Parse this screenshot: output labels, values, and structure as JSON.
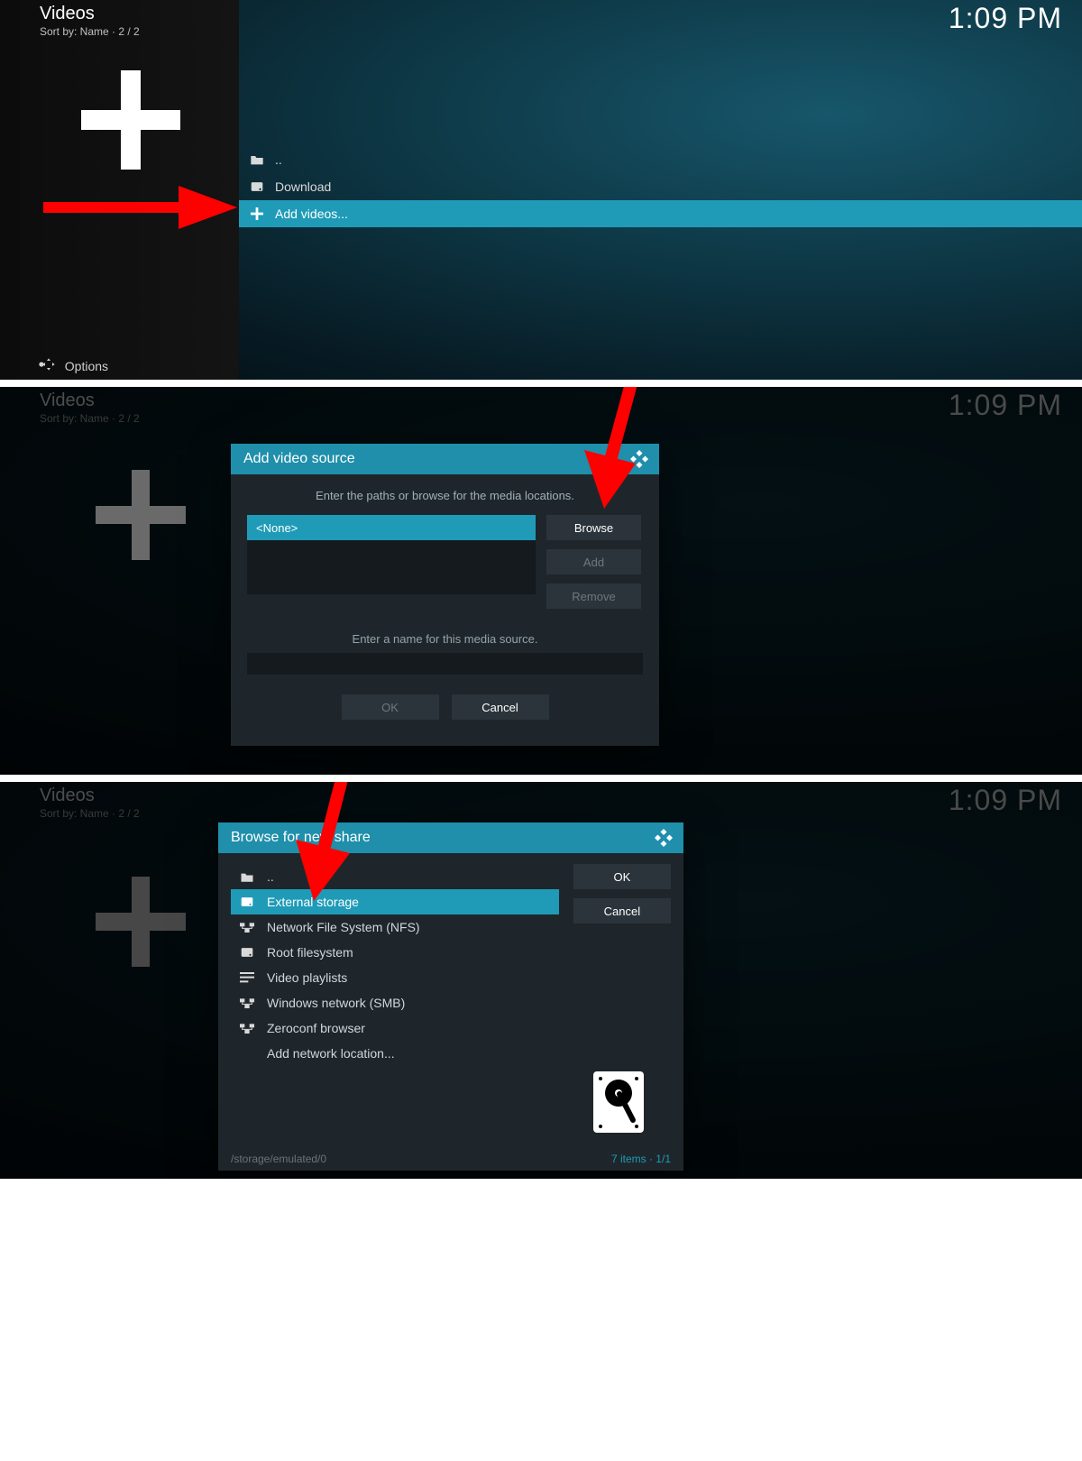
{
  "panel1": {
    "title": "Videos",
    "subtitle": "Sort by: Name  ·  2 / 2",
    "clock": "1:09 PM",
    "rows": {
      "up": "..",
      "download": "Download",
      "addvideos": "Add videos..."
    },
    "options": "Options"
  },
  "panel2": {
    "title": "Videos",
    "subtitle": "Sort by: Name  ·  2 / 2",
    "clock": "1:09 PM",
    "dialog_title": "Add video source",
    "instruction": "Enter the paths or browse for the media locations.",
    "path_none": "<None>",
    "browse": "Browse",
    "add": "Add",
    "remove": "Remove",
    "instruction2": "Enter a name for this media source.",
    "ok": "OK",
    "cancel": "Cancel"
  },
  "panel3": {
    "title": "Videos",
    "subtitle": "Sort by: Name  ·  2 / 2",
    "clock": "1:09 PM",
    "dialog_title": "Browse for new share",
    "ok": "OK",
    "cancel": "Cancel",
    "rows": {
      "up": "..",
      "ext": "External storage",
      "nfs": "Network File System (NFS)",
      "root": "Root filesystem",
      "vpl": "Video playlists",
      "smb": "Windows network (SMB)",
      "zero": "Zeroconf browser",
      "addnet": "Add network location..."
    },
    "footer_path": "/storage/emulated/0",
    "footer_count": "7 items · 1/1"
  }
}
